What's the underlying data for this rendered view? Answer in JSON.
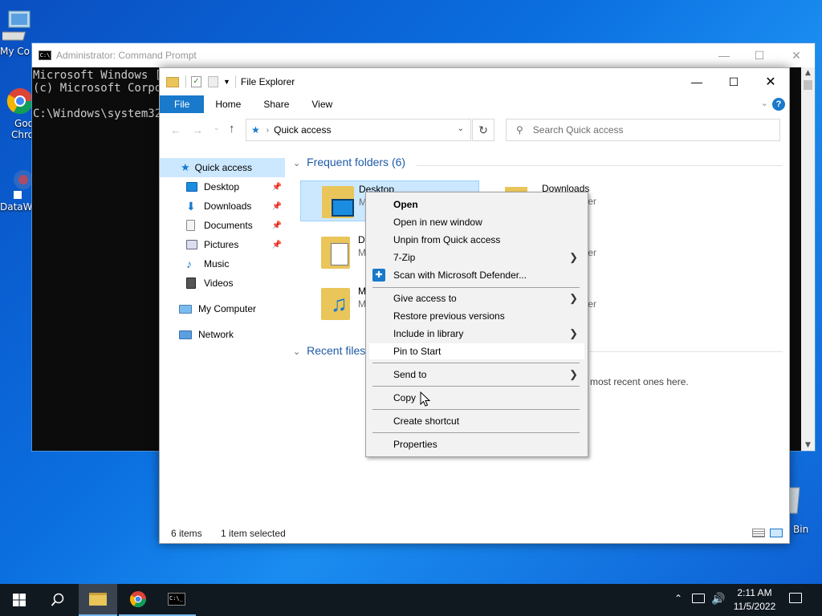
{
  "desktop": {
    "icons": [
      {
        "label": "My Co"
      },
      {
        "label": "Goo"
      },
      {
        "label": "Chro"
      },
      {
        "label": "DataW"
      },
      {
        "label": "Bin"
      }
    ]
  },
  "cmd": {
    "title": "Administrator: Command Prompt",
    "lines": [
      "Microsoft Windows [V",
      "(c) Microsoft Corpor",
      "",
      "C:\\Windows\\system32>"
    ]
  },
  "explorer": {
    "title": "File Explorer",
    "tabs": [
      "File",
      "Home",
      "Share",
      "View"
    ],
    "address": "Quick access",
    "search_placeholder": "Search Quick access",
    "nav": [
      {
        "label": "Quick access"
      },
      {
        "label": "Desktop"
      },
      {
        "label": "Downloads"
      },
      {
        "label": "Documents"
      },
      {
        "label": "Pictures"
      },
      {
        "label": "Music"
      },
      {
        "label": "Videos"
      },
      {
        "label": "My Computer"
      },
      {
        "label": "Network"
      }
    ],
    "frequent_header": "Frequent folders (6)",
    "recent_header": "Recent files",
    "folders": [
      {
        "name": "Desktop",
        "sub": "M"
      },
      {
        "name": "Downloads",
        "sub": "ter"
      },
      {
        "name": "D",
        "sub": "M"
      },
      {
        "name": "",
        "sub": "ter"
      },
      {
        "name": "M",
        "sub": "M"
      },
      {
        "name": "",
        "sub": "ter"
      }
    ],
    "recent_empty": "most recent ones here.",
    "status_items": "6 items",
    "status_selected": "1 item selected"
  },
  "context_menu": {
    "items": [
      "Open",
      "Open in new window",
      "Unpin from Quick access",
      "7-Zip",
      "Scan with Microsoft Defender...",
      "Give access to",
      "Restore previous versions",
      "Include in library",
      "Pin to Start",
      "Send to",
      "Copy",
      "Create shortcut",
      "Properties"
    ]
  },
  "taskbar": {
    "time": "2:11 AM",
    "date": "11/5/2022"
  },
  "colors": {
    "accent": "#1979ca",
    "selection": "#cce8ff"
  }
}
